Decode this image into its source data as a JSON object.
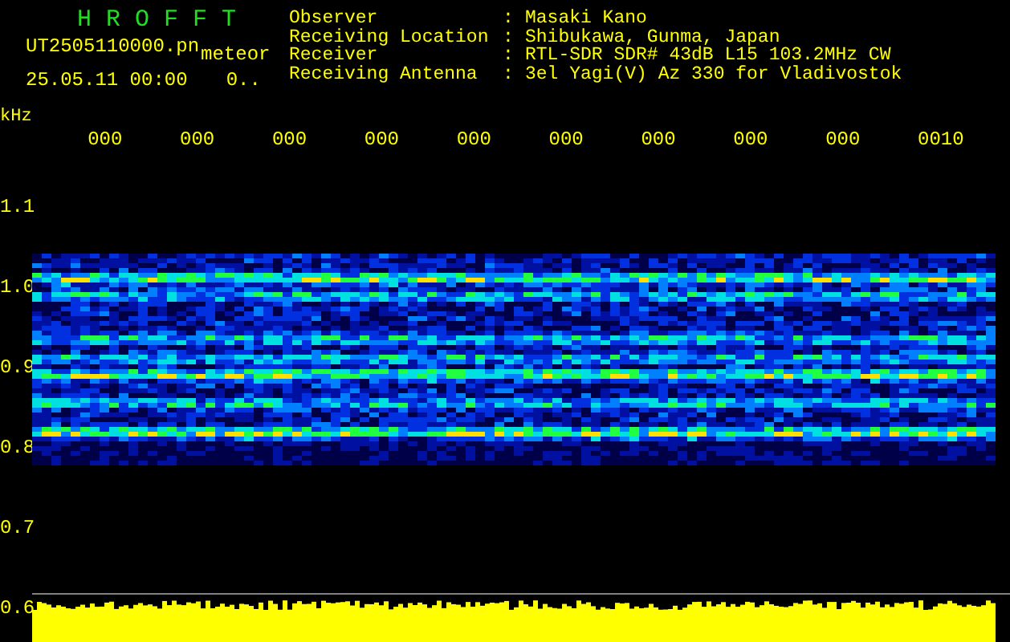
{
  "header": {
    "title": "H R O F F T",
    "file": "UT2505110000.pn",
    "file_suffix": "meteor",
    "timestamp": "25.05.11 00:00",
    "counter": "0.."
  },
  "station": [
    {
      "label": "Observer",
      "separator": ":",
      "value": "Masaki Kano"
    },
    {
      "label": "Receiving Location",
      "separator": ":",
      "value": "Shibukawa, Gunma, Japan"
    },
    {
      "label": "Receiver",
      "separator": ":",
      "value": "RTL-SDR SDR# 43dB L15 103.2MHz CW"
    },
    {
      "label": "Receiving Antenna",
      "separator": ":",
      "value": "3el Yagi(V) Az 330 for Vladivostok"
    }
  ],
  "spectrogram": {
    "y_unit": "kHz",
    "x_labels": [
      "000",
      "000",
      "000",
      "000",
      "000",
      "000",
      "000",
      "000",
      "000",
      "0010"
    ],
    "y_labels": [
      "1.1",
      "1.0",
      "0.9",
      "0.8",
      "0.7",
      "0.6"
    ]
  }
}
